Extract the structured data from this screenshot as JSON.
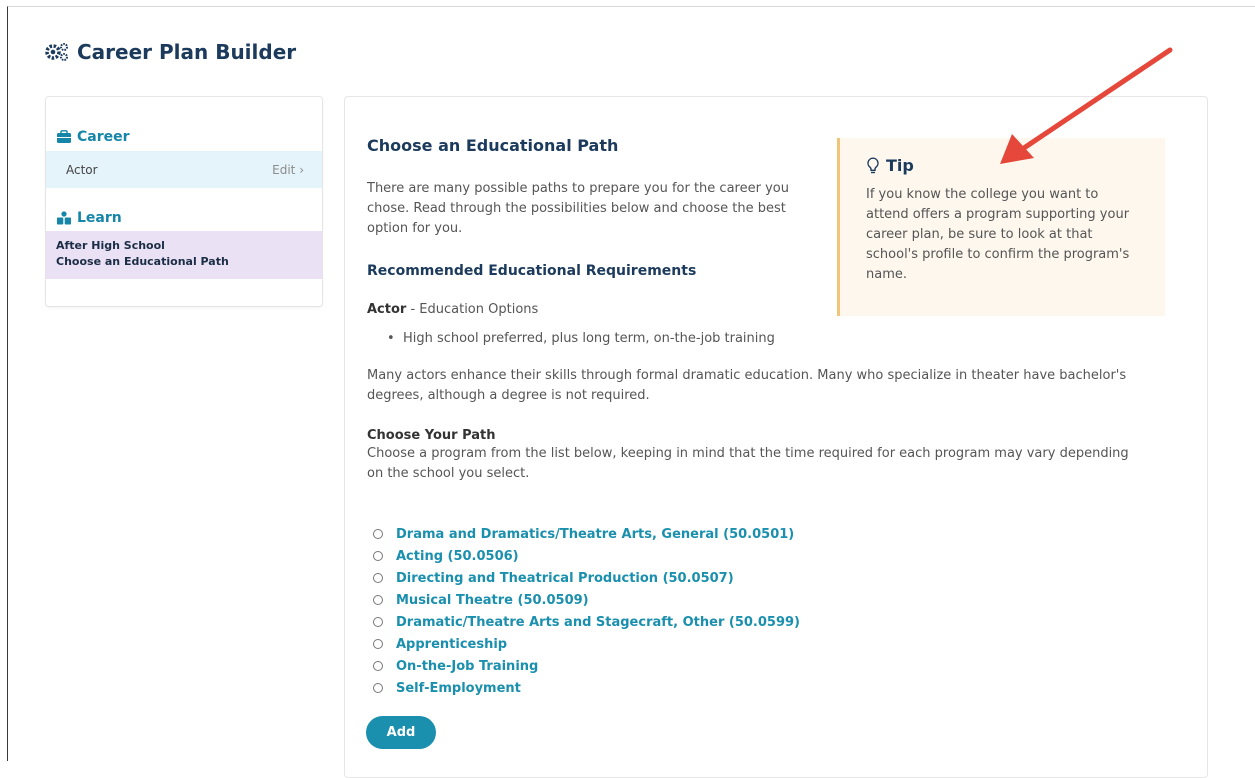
{
  "page": {
    "title": "Career Plan Builder"
  },
  "sidebar": {
    "career_heading": "Career",
    "career_value": "Actor",
    "edit_label": "Edit ›",
    "learn_heading": "Learn",
    "learn_line1": "After High School",
    "learn_line2": "Choose an Educational Path"
  },
  "main": {
    "heading": "Choose an Educational Path",
    "intro": "There are many possible paths to prepare you for the career you chose. Read through the possibilities below and choose the best option for you.",
    "requirements_heading": "Recommended Educational Requirements",
    "actor_label": "Actor",
    "actor_suffix": " - Education Options",
    "bullet": "High school preferred, plus long term, on-the-job training",
    "paragraph": "Many actors enhance their skills through formal dramatic education. Many who specialize in theater have bachelor's degrees, although a degree is not required.",
    "path_heading": "Choose Your Path",
    "path_description": "Choose a program from the list below, keeping in mind that the time required for each program may vary depending on the school you select.",
    "options": [
      "Drama and Dramatics/Theatre Arts, General (50.0501)",
      "Acting (50.0506)",
      "Directing and Theatrical Production (50.0507)",
      "Musical Theatre (50.0509)",
      "Dramatic/Theatre Arts and Stagecraft, Other (50.0599)",
      "Apprenticeship",
      "On-the-Job Training",
      "Self-Employment"
    ],
    "add_label": "Add"
  },
  "tip": {
    "heading": "Tip",
    "body": "If you know the college you want to attend offers a program supporting your career plan, be sure to look at that school's profile to confirm the program's name."
  },
  "colors": {
    "accent": "#1a8fae",
    "heading": "#1b3a5c",
    "career_row_bg": "#e5f3fa",
    "learn_row_bg": "#ebe1f5",
    "tip_bg": "#fdf7ee",
    "tip_border": "#f2c478",
    "arrow": "#e5473a"
  },
  "icons": {
    "title": "gears-icon",
    "career": "briefcase-icon",
    "learn": "learn-icon",
    "tip": "lightbulb-icon"
  }
}
